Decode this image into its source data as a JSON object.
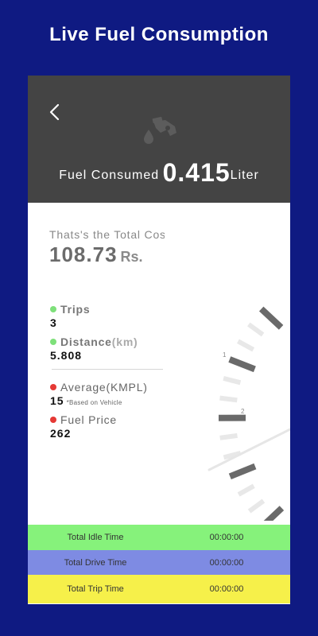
{
  "banner": {
    "title": "Live Fuel Consumption"
  },
  "header": {
    "fuel_label": "Fuel Consumed",
    "fuel_value": "0.415",
    "fuel_unit": "Liter",
    "back_icon": "chevron-left-icon",
    "pump_icon": "fuel-pump-icon"
  },
  "summary": {
    "total_label": "Thats's the Total Cost",
    "total_amount": "108.73",
    "total_unit": "Rs."
  },
  "stats": {
    "trips": {
      "label": "Trips",
      "value": "3"
    },
    "distance": {
      "label": "Distance",
      "unit": "(km)",
      "value": "5.808"
    },
    "average": {
      "label": "Average",
      "unit": "(KMPL)",
      "value": "15",
      "note": "*Based on Vehicle"
    },
    "fuel_price": {
      "label": "Fuel Price",
      "value": "262"
    }
  },
  "gauge": {
    "tick_labels": [
      "1",
      "2"
    ]
  },
  "time_bars": [
    {
      "label": "Total Idle Time",
      "value": "00:00:00"
    },
    {
      "label": "Total Drive Time",
      "value": "00:00:00"
    },
    {
      "label": "Total Trip Time",
      "value": "00:00:00"
    }
  ],
  "colors": {
    "background": "#0f1a82",
    "header": "#444444",
    "idle": "#86f27b",
    "drive": "#7e8be3",
    "trip": "#f6f04a",
    "dot_green": "#7ee07a",
    "dot_red": "#e53935"
  }
}
